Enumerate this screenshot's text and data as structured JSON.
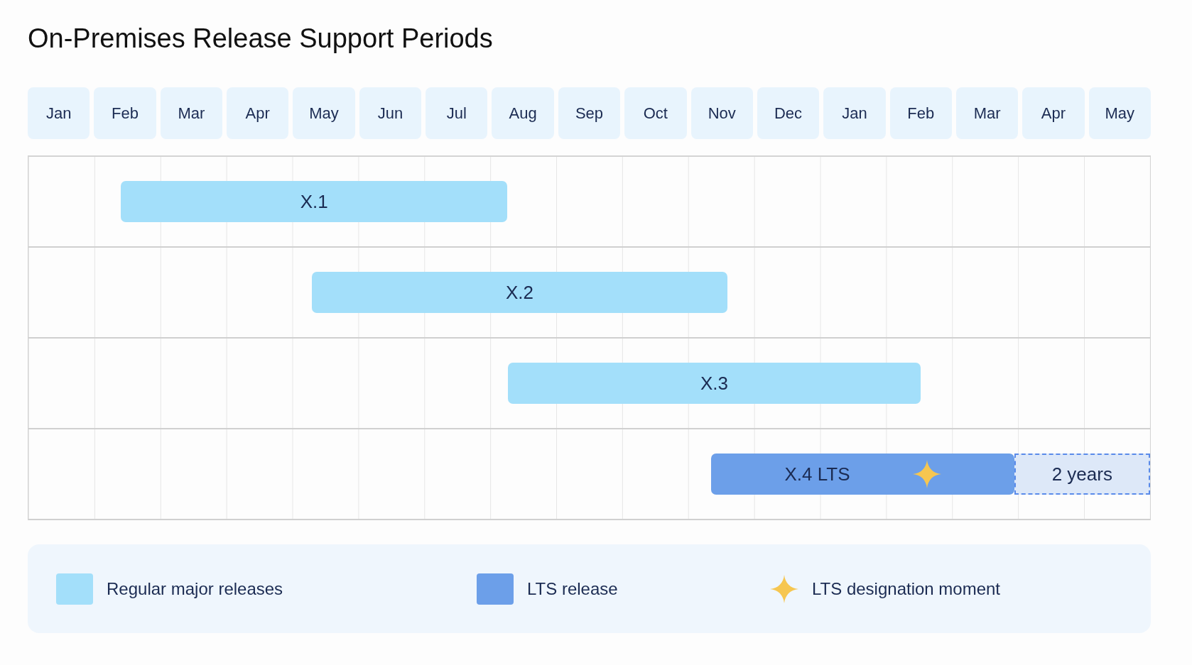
{
  "title": "On-Premises Release Support Periods",
  "months": [
    "Jan",
    "Feb",
    "Mar",
    "Apr",
    "May",
    "Jun",
    "Jul",
    "Aug",
    "Sep",
    "Oct",
    "Nov",
    "Dec",
    "Jan",
    "Feb",
    "Mar",
    "Apr",
    "May"
  ],
  "releases": [
    {
      "label": "X.1",
      "kind": "regular"
    },
    {
      "label": "X.2",
      "kind": "regular"
    },
    {
      "label": "X.3",
      "kind": "regular"
    },
    {
      "label": "X.4 LTS",
      "kind": "lts",
      "designation_marker": true,
      "extension": {
        "label": "2 years"
      }
    }
  ],
  "legend": [
    {
      "kind": "regular",
      "label": "Regular major releases"
    },
    {
      "kind": "lts",
      "label": "LTS release"
    },
    {
      "kind": "designation",
      "label": "LTS designation moment"
    }
  ]
}
